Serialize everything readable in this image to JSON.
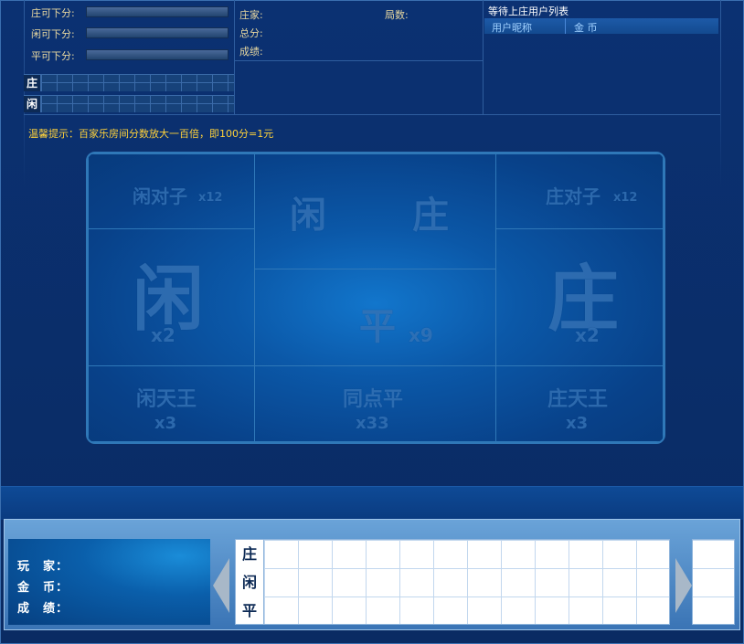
{
  "top": {
    "bet_limits": [
      {
        "label": "庄可下分:"
      },
      {
        "label": "闲可下分:"
      },
      {
        "label": "平可下分:"
      }
    ],
    "road": [
      {
        "tag": "庄"
      },
      {
        "tag": "闲"
      }
    ],
    "info": {
      "banker": "庄家:",
      "rounds": "局数:",
      "total": "总分:",
      "score": "成绩:"
    },
    "queue": {
      "title": "等待上庄用户列表",
      "col_nick": "用户昵称",
      "col_coins": "金 币"
    }
  },
  "tip": "温馨提示：百家乐房间分数放大一百倍，即100分=1元",
  "bet_table": {
    "player_pair": {
      "name": "闲对子",
      "odds": "x12"
    },
    "banker_pair": {
      "name": "庄对子",
      "odds": "x12"
    },
    "top_player": "闲",
    "top_banker": "庄",
    "player": {
      "name": "闲",
      "odds": "x2"
    },
    "tie": {
      "name": "平",
      "odds": "x9"
    },
    "banker": {
      "name": "庄",
      "odds": "x2"
    },
    "player_king": {
      "name": "闲天王",
      "odds": "x3"
    },
    "same_tie": {
      "name": "同点平",
      "odds": "x33"
    },
    "banker_king": {
      "name": "庄天王",
      "odds": "x3"
    }
  },
  "player_info": {
    "player": "玩　家：",
    "coins": "金　币：",
    "score": "成　绩："
  },
  "history": {
    "rows": [
      "庄",
      "闲",
      "平"
    ]
  },
  "colors": {
    "accent_yellow": "#ffd23a",
    "label": "#e8d8a0",
    "table_border": "#2f78b8"
  },
  "icons": [
    "arrow-left-icon",
    "arrow-right-icon"
  ]
}
